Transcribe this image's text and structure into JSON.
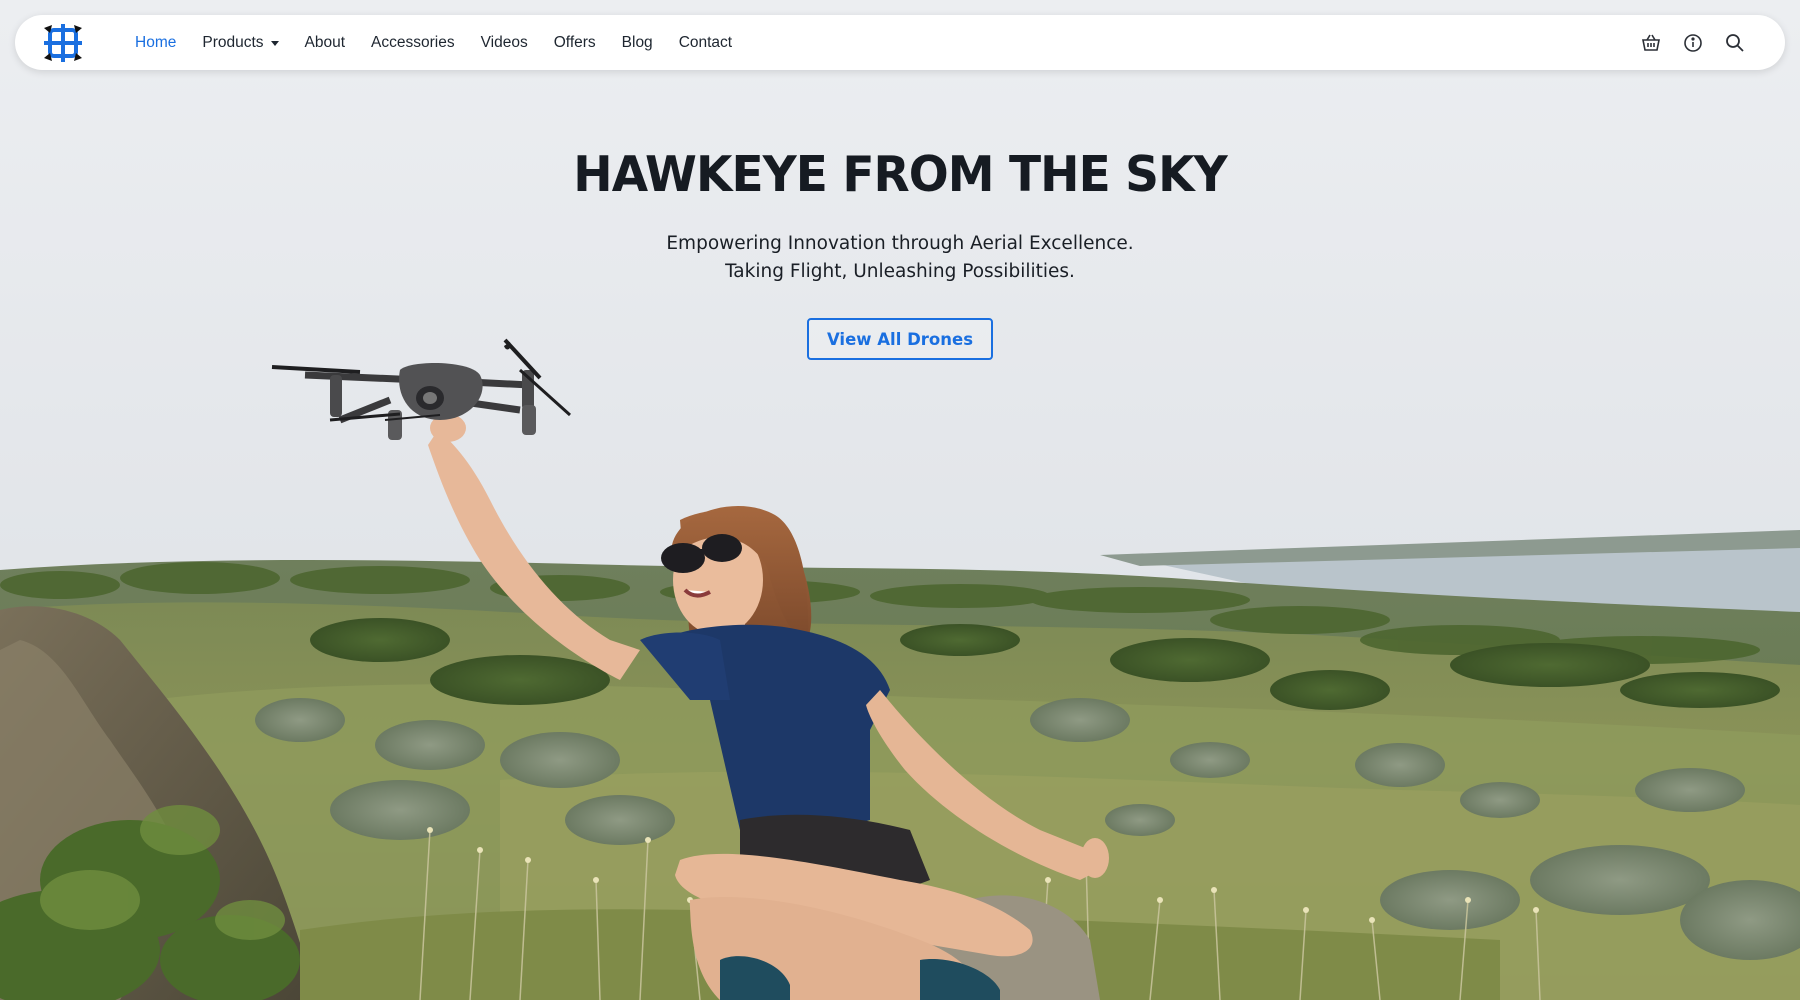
{
  "nav": {
    "logo_name": "drone-logo",
    "links": [
      {
        "label": "Home",
        "active": true
      },
      {
        "label": "Products",
        "dropdown": true
      },
      {
        "label": "About"
      },
      {
        "label": "Accessories"
      },
      {
        "label": "Videos"
      },
      {
        "label": "Offers"
      },
      {
        "label": "Blog"
      },
      {
        "label": "Contact"
      }
    ],
    "icons": [
      "cart-icon",
      "info-icon",
      "search-icon"
    ]
  },
  "hero": {
    "title": "HAWKEYE FROM THE SKY",
    "subtitle_line1": "Empowering Innovation through Aerial Excellence.",
    "subtitle_line2": "Taking Flight, Unleashing Possibilities.",
    "cta_label": "View All Drones"
  },
  "colors": {
    "accent": "#1a6fe0",
    "text": "#161b22",
    "navbar_bg": "#ffffff",
    "sky": "#e9ebee"
  }
}
